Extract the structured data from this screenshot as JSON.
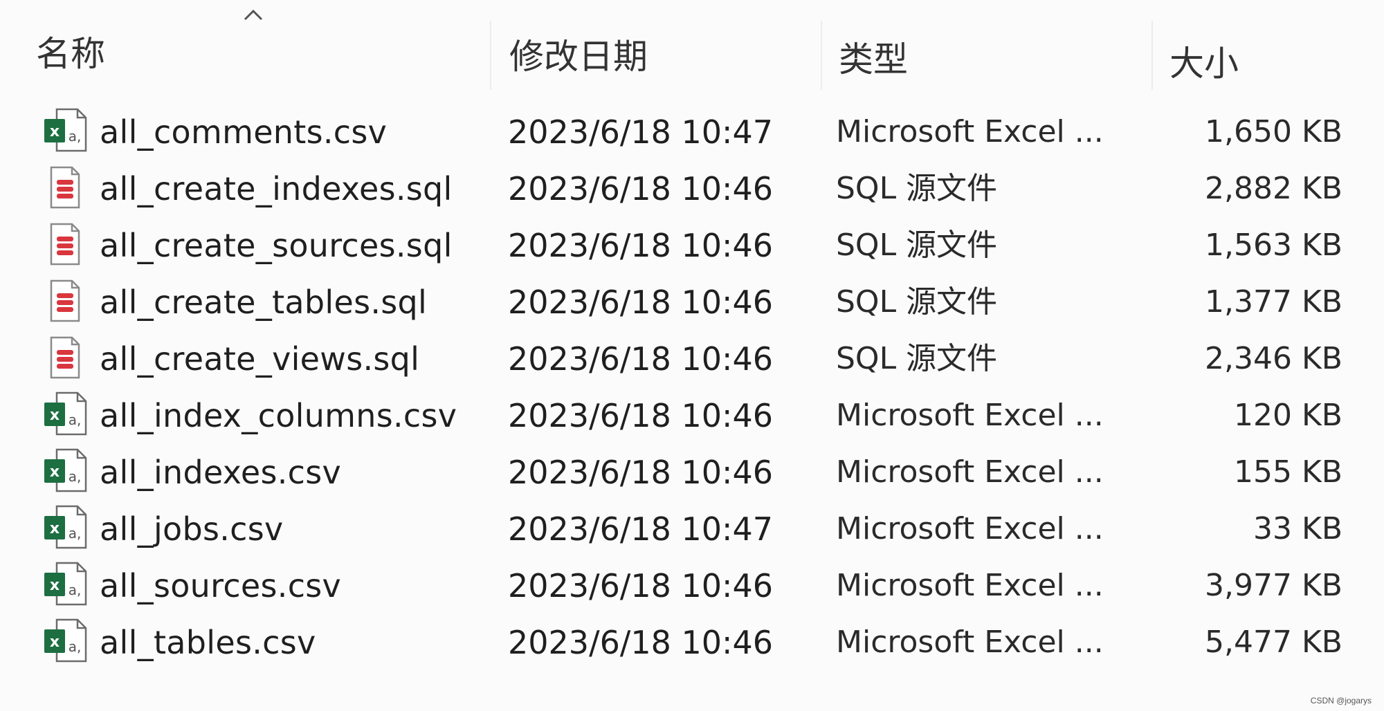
{
  "columns": {
    "name": "名称",
    "date": "修改日期",
    "type": "类型",
    "size": "大小"
  },
  "files": [
    {
      "name": "all_comments.csv",
      "date": "2023/6/18 10:47",
      "type": "Microsoft Excel ...",
      "size": "1,650 KB",
      "icon": "excel-csv-icon"
    },
    {
      "name": "all_create_indexes.sql",
      "date": "2023/6/18 10:46",
      "type": "SQL 源文件",
      "size": "2,882 KB",
      "icon": "sql-file-icon"
    },
    {
      "name": "all_create_sources.sql",
      "date": "2023/6/18 10:46",
      "type": "SQL 源文件",
      "size": "1,563 KB",
      "icon": "sql-file-icon"
    },
    {
      "name": "all_create_tables.sql",
      "date": "2023/6/18 10:46",
      "type": "SQL 源文件",
      "size": "1,377 KB",
      "icon": "sql-file-icon"
    },
    {
      "name": "all_create_views.sql",
      "date": "2023/6/18 10:46",
      "type": "SQL 源文件",
      "size": "2,346 KB",
      "icon": "sql-file-icon"
    },
    {
      "name": "all_index_columns.csv",
      "date": "2023/6/18 10:46",
      "type": "Microsoft Excel ...",
      "size": "120 KB",
      "icon": "excel-csv-icon"
    },
    {
      "name": "all_indexes.csv",
      "date": "2023/6/18 10:46",
      "type": "Microsoft Excel ...",
      "size": "155 KB",
      "icon": "excel-csv-icon"
    },
    {
      "name": "all_jobs.csv",
      "date": "2023/6/18 10:47",
      "type": "Microsoft Excel ...",
      "size": "33 KB",
      "icon": "excel-csv-icon"
    },
    {
      "name": "all_sources.csv",
      "date": "2023/6/18 10:46",
      "type": "Microsoft Excel ...",
      "size": "3,977 KB",
      "icon": "excel-csv-icon"
    },
    {
      "name": "all_tables.csv",
      "date": "2023/6/18 10:46",
      "type": "Microsoft Excel ...",
      "size": "5,477 KB",
      "icon": "excel-csv-icon"
    }
  ],
  "watermark": "CSDN @jogarys",
  "colors": {
    "excel_green": "#1d6f42",
    "sql_red": "#d9363e"
  }
}
